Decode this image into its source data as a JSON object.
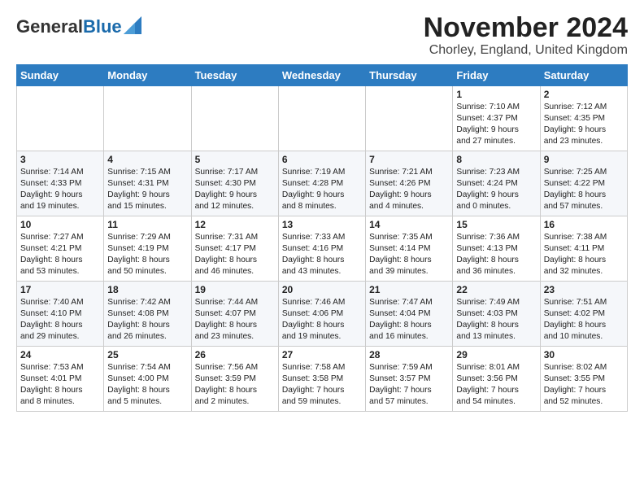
{
  "header": {
    "logo_general": "General",
    "logo_blue": "Blue",
    "title": "November 2024",
    "subtitle": "Chorley, England, United Kingdom"
  },
  "weekdays": [
    "Sunday",
    "Monday",
    "Tuesday",
    "Wednesday",
    "Thursday",
    "Friday",
    "Saturday"
  ],
  "weeks": [
    [
      {
        "day": "",
        "info": ""
      },
      {
        "day": "",
        "info": ""
      },
      {
        "day": "",
        "info": ""
      },
      {
        "day": "",
        "info": ""
      },
      {
        "day": "",
        "info": ""
      },
      {
        "day": "1",
        "info": "Sunrise: 7:10 AM\nSunset: 4:37 PM\nDaylight: 9 hours\nand 27 minutes."
      },
      {
        "day": "2",
        "info": "Sunrise: 7:12 AM\nSunset: 4:35 PM\nDaylight: 9 hours\nand 23 minutes."
      }
    ],
    [
      {
        "day": "3",
        "info": "Sunrise: 7:14 AM\nSunset: 4:33 PM\nDaylight: 9 hours\nand 19 minutes."
      },
      {
        "day": "4",
        "info": "Sunrise: 7:15 AM\nSunset: 4:31 PM\nDaylight: 9 hours\nand 15 minutes."
      },
      {
        "day": "5",
        "info": "Sunrise: 7:17 AM\nSunset: 4:30 PM\nDaylight: 9 hours\nand 12 minutes."
      },
      {
        "day": "6",
        "info": "Sunrise: 7:19 AM\nSunset: 4:28 PM\nDaylight: 9 hours\nand 8 minutes."
      },
      {
        "day": "7",
        "info": "Sunrise: 7:21 AM\nSunset: 4:26 PM\nDaylight: 9 hours\nand 4 minutes."
      },
      {
        "day": "8",
        "info": "Sunrise: 7:23 AM\nSunset: 4:24 PM\nDaylight: 9 hours\nand 0 minutes."
      },
      {
        "day": "9",
        "info": "Sunrise: 7:25 AM\nSunset: 4:22 PM\nDaylight: 8 hours\nand 57 minutes."
      }
    ],
    [
      {
        "day": "10",
        "info": "Sunrise: 7:27 AM\nSunset: 4:21 PM\nDaylight: 8 hours\nand 53 minutes."
      },
      {
        "day": "11",
        "info": "Sunrise: 7:29 AM\nSunset: 4:19 PM\nDaylight: 8 hours\nand 50 minutes."
      },
      {
        "day": "12",
        "info": "Sunrise: 7:31 AM\nSunset: 4:17 PM\nDaylight: 8 hours\nand 46 minutes."
      },
      {
        "day": "13",
        "info": "Sunrise: 7:33 AM\nSunset: 4:16 PM\nDaylight: 8 hours\nand 43 minutes."
      },
      {
        "day": "14",
        "info": "Sunrise: 7:35 AM\nSunset: 4:14 PM\nDaylight: 8 hours\nand 39 minutes."
      },
      {
        "day": "15",
        "info": "Sunrise: 7:36 AM\nSunset: 4:13 PM\nDaylight: 8 hours\nand 36 minutes."
      },
      {
        "day": "16",
        "info": "Sunrise: 7:38 AM\nSunset: 4:11 PM\nDaylight: 8 hours\nand 32 minutes."
      }
    ],
    [
      {
        "day": "17",
        "info": "Sunrise: 7:40 AM\nSunset: 4:10 PM\nDaylight: 8 hours\nand 29 minutes."
      },
      {
        "day": "18",
        "info": "Sunrise: 7:42 AM\nSunset: 4:08 PM\nDaylight: 8 hours\nand 26 minutes."
      },
      {
        "day": "19",
        "info": "Sunrise: 7:44 AM\nSunset: 4:07 PM\nDaylight: 8 hours\nand 23 minutes."
      },
      {
        "day": "20",
        "info": "Sunrise: 7:46 AM\nSunset: 4:06 PM\nDaylight: 8 hours\nand 19 minutes."
      },
      {
        "day": "21",
        "info": "Sunrise: 7:47 AM\nSunset: 4:04 PM\nDaylight: 8 hours\nand 16 minutes."
      },
      {
        "day": "22",
        "info": "Sunrise: 7:49 AM\nSunset: 4:03 PM\nDaylight: 8 hours\nand 13 minutes."
      },
      {
        "day": "23",
        "info": "Sunrise: 7:51 AM\nSunset: 4:02 PM\nDaylight: 8 hours\nand 10 minutes."
      }
    ],
    [
      {
        "day": "24",
        "info": "Sunrise: 7:53 AM\nSunset: 4:01 PM\nDaylight: 8 hours\nand 8 minutes."
      },
      {
        "day": "25",
        "info": "Sunrise: 7:54 AM\nSunset: 4:00 PM\nDaylight: 8 hours\nand 5 minutes."
      },
      {
        "day": "26",
        "info": "Sunrise: 7:56 AM\nSunset: 3:59 PM\nDaylight: 8 hours\nand 2 minutes."
      },
      {
        "day": "27",
        "info": "Sunrise: 7:58 AM\nSunset: 3:58 PM\nDaylight: 7 hours\nand 59 minutes."
      },
      {
        "day": "28",
        "info": "Sunrise: 7:59 AM\nSunset: 3:57 PM\nDaylight: 7 hours\nand 57 minutes."
      },
      {
        "day": "29",
        "info": "Sunrise: 8:01 AM\nSunset: 3:56 PM\nDaylight: 7 hours\nand 54 minutes."
      },
      {
        "day": "30",
        "info": "Sunrise: 8:02 AM\nSunset: 3:55 PM\nDaylight: 7 hours\nand 52 minutes."
      }
    ]
  ]
}
